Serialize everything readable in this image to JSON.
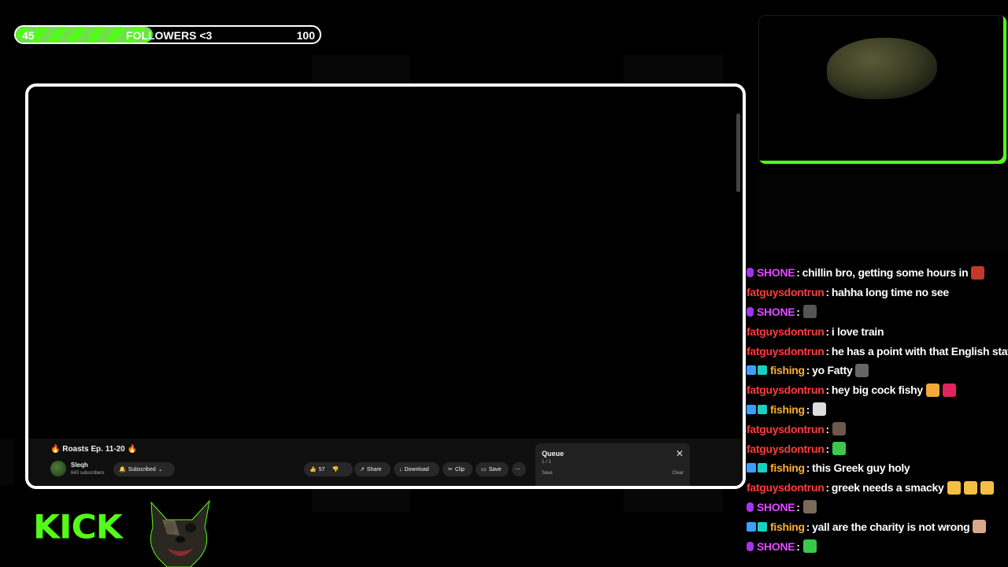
{
  "goal": {
    "start": "45",
    "label": "FOLLOWERS <3",
    "end": "100",
    "progress_fraction": 0.45
  },
  "video": {
    "title": "🔥 Roasts Ep. 11-20 🔥",
    "channel_name": "Sleqh",
    "channel_subs": "643 subscribers",
    "subscribed_label": "Subscribed",
    "likes": "57",
    "share_label": "Share",
    "download_label": "Download",
    "clip_label": "Clip",
    "save_label": "Save",
    "more_label": "⋯"
  },
  "queue": {
    "title": "Queue",
    "count": "1 / 1",
    "close": "✕",
    "save": "Save",
    "clear": "Clear"
  },
  "chat": [
    {
      "badge": "mic",
      "user": "SHONE",
      "color": "#e04bff",
      "msg": "chillin bro, getting some hours in",
      "emotes": [
        "#c0392b"
      ]
    },
    {
      "badge": "",
      "user": "fatguysdontrun",
      "color": "#ff3b3b",
      "msg": "hahha long time no see",
      "emotes": []
    },
    {
      "badge": "mic",
      "user": "SHONE",
      "color": "#e04bff",
      "msg": "",
      "emotes": [
        "#555555"
      ]
    },
    {
      "badge": "",
      "user": "fatguysdontrun",
      "color": "#ff3b3b",
      "msg": "i love train",
      "emotes": []
    },
    {
      "badge": "",
      "user": "fatguysdontrun",
      "color": "#ff3b3b",
      "msg": "he has a point with that English stat",
      "emotes": []
    },
    {
      "badge": "bits",
      "user": "fishing",
      "color": "#ffb02e",
      "msg": "yo Fatty",
      "emotes": [
        "#666666"
      ]
    },
    {
      "badge": "",
      "user": "fatguysdontrun",
      "color": "#ff3b3b",
      "msg": "hey big cock fishy",
      "emotes": [
        "#f2a93b",
        "#e0245e"
      ]
    },
    {
      "badge": "bits",
      "user": "fishing",
      "color": "#ffb02e",
      "msg": "",
      "emotes": [
        "#dddddd"
      ]
    },
    {
      "badge": "",
      "user": "fatguysdontrun",
      "color": "#ff3b3b",
      "msg": "",
      "emotes": [
        "#6b5a4a"
      ]
    },
    {
      "badge": "",
      "user": "fatguysdontrun",
      "color": "#ff3b3b",
      "msg": "",
      "emotes": [
        "#3ac94a"
      ]
    },
    {
      "badge": "bits",
      "user": "fishing",
      "color": "#ffb02e",
      "msg": "this Greek guy holy",
      "emotes": []
    },
    {
      "badge": "",
      "user": "fatguysdontrun",
      "color": "#ff3b3b",
      "msg": "greek needs a smacky",
      "emotes": [
        "#f5c042",
        "#f5c042",
        "#f5c042"
      ]
    },
    {
      "badge": "mic",
      "user": "SHONE",
      "color": "#e04bff",
      "msg": "",
      "emotes": [
        "#7a6a5a"
      ]
    },
    {
      "badge": "bits",
      "user": "fishing",
      "color": "#ffb02e",
      "msg": "yall are the charity is not wrong",
      "emotes": [
        "#d9a88a"
      ]
    },
    {
      "badge": "mic",
      "user": "SHONE",
      "color": "#e04bff",
      "msg": "",
      "emotes": [
        "#3ac94a"
      ]
    }
  ],
  "kick_logo": "KICK",
  "colors": {
    "accent": "#53fc18",
    "chat_red": "#ff3b3b",
    "chat_purple": "#e04bff",
    "chat_orange": "#ffb02e"
  }
}
